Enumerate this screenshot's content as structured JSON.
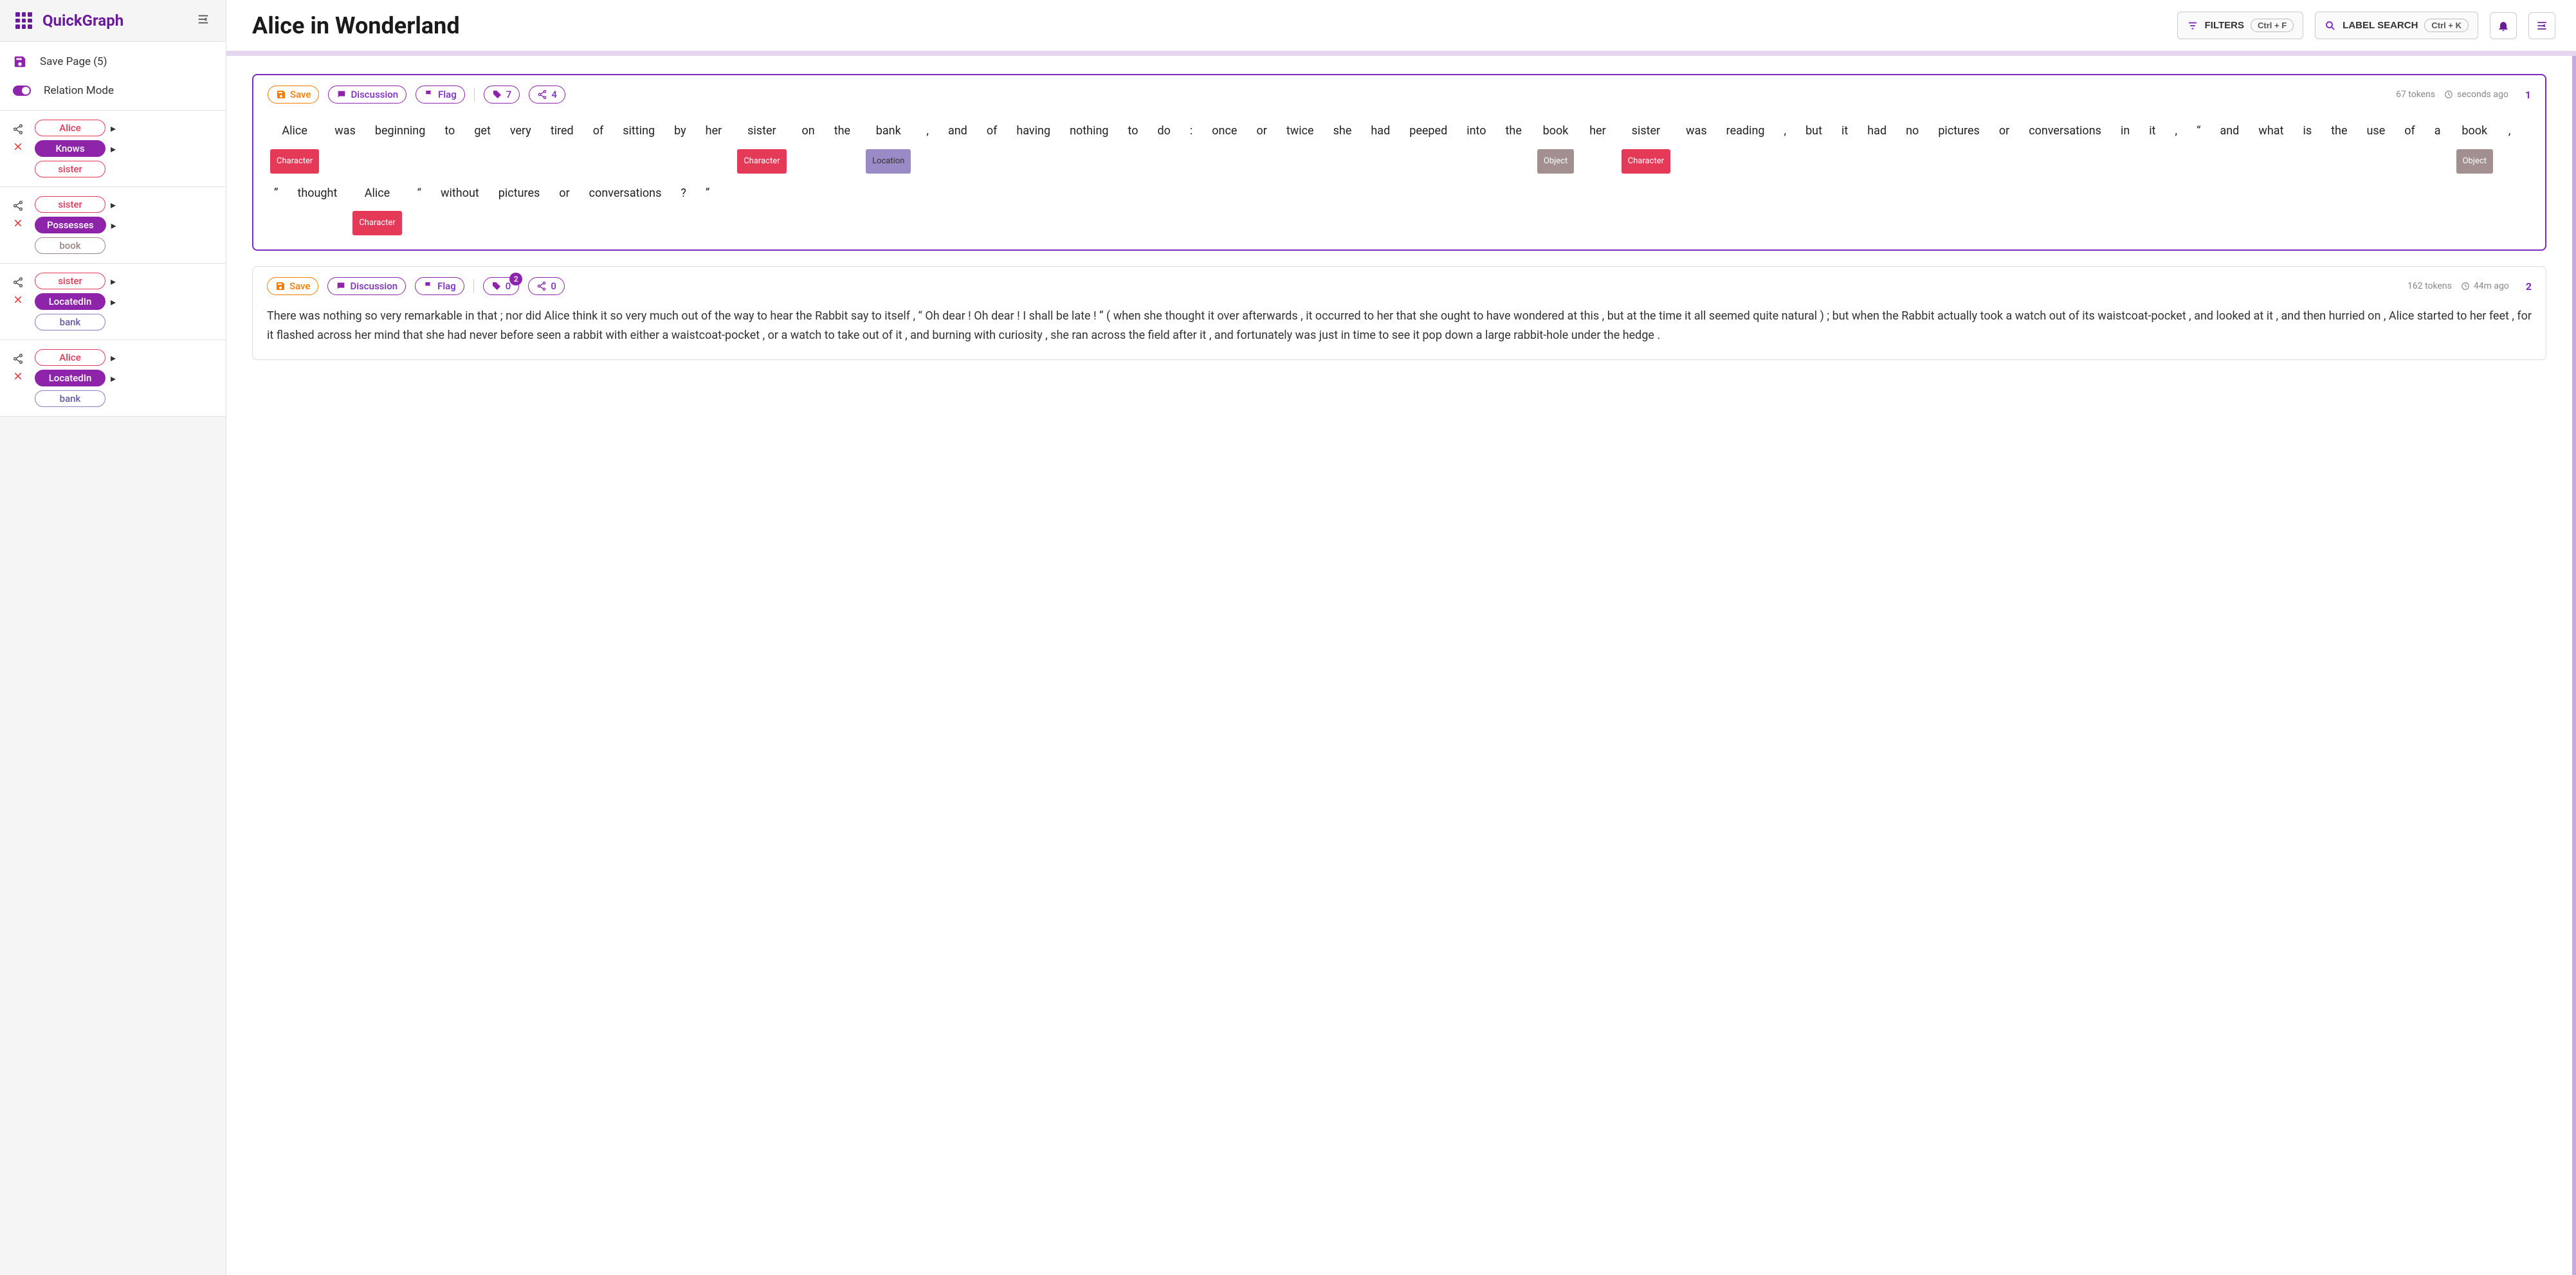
{
  "brand": "QuickGraph",
  "page_title": "Alice in Wonderland",
  "topbar": {
    "filters_label": "FILTERS",
    "filters_kbd": "Ctrl + F",
    "search_label": "LABEL SEARCH",
    "search_kbd": "Ctrl + K"
  },
  "sidebar": {
    "save_label": "Save Page (5)",
    "mode_label": "Relation Mode",
    "relations": [
      {
        "source": "Alice",
        "source_type": "entity-red",
        "rel": "Knows",
        "target": "sister",
        "target_type": "entity-red"
      },
      {
        "source": "sister",
        "source_type": "entity-red",
        "rel": "Possesses",
        "target": "book",
        "target_type": "entity-brown"
      },
      {
        "source": "sister",
        "source_type": "entity-red",
        "rel": "LocatedIn",
        "target": "bank",
        "target_type": "entity-purple"
      },
      {
        "source": "Alice",
        "source_type": "entity-red",
        "rel": "LocatedIn",
        "target": "bank",
        "target_type": "entity-purple"
      }
    ]
  },
  "cards": [
    {
      "index": "1",
      "tokens_meta": "67 tokens",
      "time_meta": "seconds ago",
      "toolbar": {
        "save": "Save",
        "discussion": "Discussion",
        "flag": "Flag",
        "tag_count": "7",
        "share_count": "4",
        "badge": null
      },
      "tokens": [
        {
          "w": "Alice",
          "l": "Character"
        },
        {
          "w": "was"
        },
        {
          "w": "beginning"
        },
        {
          "w": "to"
        },
        {
          "w": "get"
        },
        {
          "w": "very"
        },
        {
          "w": "tired"
        },
        {
          "w": "of"
        },
        {
          "w": "sitting"
        },
        {
          "w": "by"
        },
        {
          "w": "her"
        },
        {
          "w": "sister",
          "l": "Character"
        },
        {
          "w": "on"
        },
        {
          "w": "the"
        },
        {
          "w": "bank",
          "l": "Location"
        },
        {
          "w": ","
        },
        {
          "w": "and"
        },
        {
          "w": "of"
        },
        {
          "w": "having"
        },
        {
          "w": "nothing"
        },
        {
          "w": "to"
        },
        {
          "w": "do"
        },
        {
          "w": ":"
        },
        {
          "w": "once"
        },
        {
          "w": "or"
        },
        {
          "w": "twice"
        },
        {
          "w": "she"
        },
        {
          "w": "had"
        },
        {
          "w": "peeped"
        },
        {
          "w": "into"
        },
        {
          "w": "the"
        },
        {
          "w": "book",
          "l": "Object"
        },
        {
          "w": "her"
        },
        {
          "w": "sister",
          "l": "Character"
        },
        {
          "w": "was"
        },
        {
          "w": "reading"
        },
        {
          "w": ","
        },
        {
          "w": "but"
        },
        {
          "w": "it"
        },
        {
          "w": "had"
        },
        {
          "w": "no"
        },
        {
          "w": "pictures"
        },
        {
          "w": "or"
        },
        {
          "w": "conversations"
        },
        {
          "w": "in"
        },
        {
          "w": "it"
        },
        {
          "w": ","
        },
        {
          "w": "“"
        },
        {
          "w": "and"
        },
        {
          "w": "what"
        },
        {
          "w": "is"
        },
        {
          "w": "the"
        },
        {
          "w": "use"
        },
        {
          "w": "of"
        },
        {
          "w": "a"
        },
        {
          "w": "book",
          "l": "Object"
        },
        {
          "w": ","
        },
        {
          "w": "”"
        },
        {
          "w": "thought"
        },
        {
          "w": "Alice",
          "l": "Character"
        },
        {
          "w": "“"
        },
        {
          "w": "without"
        },
        {
          "w": "pictures"
        },
        {
          "w": "or"
        },
        {
          "w": "conversations"
        },
        {
          "w": "?"
        },
        {
          "w": "”"
        }
      ]
    },
    {
      "index": "2",
      "tokens_meta": "162 tokens",
      "time_meta": "44m ago",
      "toolbar": {
        "save": "Save",
        "discussion": "Discussion",
        "flag": "Flag",
        "tag_count": "0",
        "share_count": "0",
        "badge": "2"
      },
      "text": "There was nothing so very remarkable in that ; nor did Alice think it so very much out of the way to hear the Rabbit say to itself , “ Oh dear ! Oh dear ! I shall be late ! ” ( when she thought it over afterwards , it occurred to her that she ought to have wondered at this , but at the time it all seemed quite natural ) ; but when the Rabbit actually took a watch out of its waistcoat-pocket , and looked at it , and then hurried on , Alice started to her feet , for it flashed across her mind that she had never before seen a rabbit with either a waistcoat-pocket , or a watch to take out of it , and burning with curiosity , she ran across the field after it , and fortunately was just in time to see it pop down a large rabbit-hole under the hedge ."
    }
  ]
}
